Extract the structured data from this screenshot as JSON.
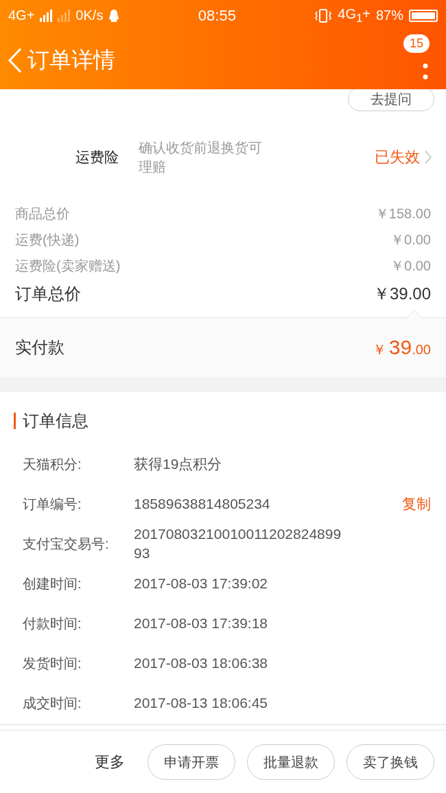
{
  "status_bar": {
    "network_1": "4G+",
    "speed": "0K/s",
    "time": "08:55",
    "network_2": "4G$_{1}$+",
    "battery": "87%"
  },
  "header": {
    "title": "订单详情",
    "badge": "15"
  },
  "ask_button": "去提问",
  "insurance": {
    "label": "运费险",
    "description": "确认收货前退换货可理赔",
    "status": "已失效"
  },
  "price_rows": [
    {
      "label": "商品总价",
      "value": "￥158.00",
      "kind": "minor"
    },
    {
      "label": "运费(快递)",
      "value": "￥0.00",
      "kind": "minor"
    },
    {
      "label": "运费险(卖家赠送)",
      "value": "￥0.00",
      "kind": "minor"
    },
    {
      "label": "订单总价",
      "value": "￥39.00",
      "kind": "total"
    }
  ],
  "paid": {
    "label": "实付款",
    "currency": "￥",
    "integer": "39",
    "decimals": ".00"
  },
  "order_info": {
    "title": "订单信息",
    "rows": [
      {
        "label": "天猫积分:",
        "value": "获得19点积分"
      },
      {
        "label": "订单编号:",
        "value": "18589638814805234",
        "action": "复制"
      },
      {
        "label": "支付宝交易号:",
        "value": "2017080321001001120282489993"
      },
      {
        "label": "创建时间:",
        "value": "2017-08-03 17:39:02"
      },
      {
        "label": "付款时间:",
        "value": "2017-08-03 17:39:18"
      },
      {
        "label": "发货时间:",
        "value": "2017-08-03 18:06:38"
      },
      {
        "label": "成交时间:",
        "value": "2017-08-13 18:06:45"
      }
    ]
  },
  "bottom_bar": {
    "more": "更多",
    "buttons": [
      "申请开票",
      "批量退款",
      "卖了换钱"
    ]
  }
}
